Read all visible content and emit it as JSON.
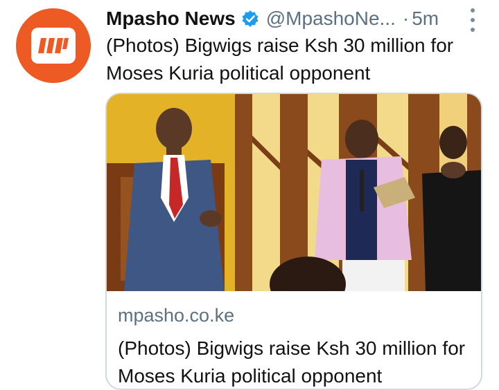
{
  "tweet": {
    "author_name": "Mpasho News",
    "handle": "@MpashoNe...",
    "separator": "·",
    "time": "5m",
    "text": "(Photos) Bigwigs raise Ksh 30 million for Moses Kuria political opponent",
    "avatar_icon": "mpasho-logo-icon",
    "verified_icon": "verified-badge-icon",
    "more_icon": "more-vertical-icon"
  },
  "card": {
    "domain": "mpasho.co.ke",
    "title": "(Photos) Bigwigs raise Ksh 30 million for Moses Kuria political opponent"
  },
  "colors": {
    "brand": "#ee5a24",
    "verified": "#1d9bf0",
    "muted": "#5b7083"
  }
}
